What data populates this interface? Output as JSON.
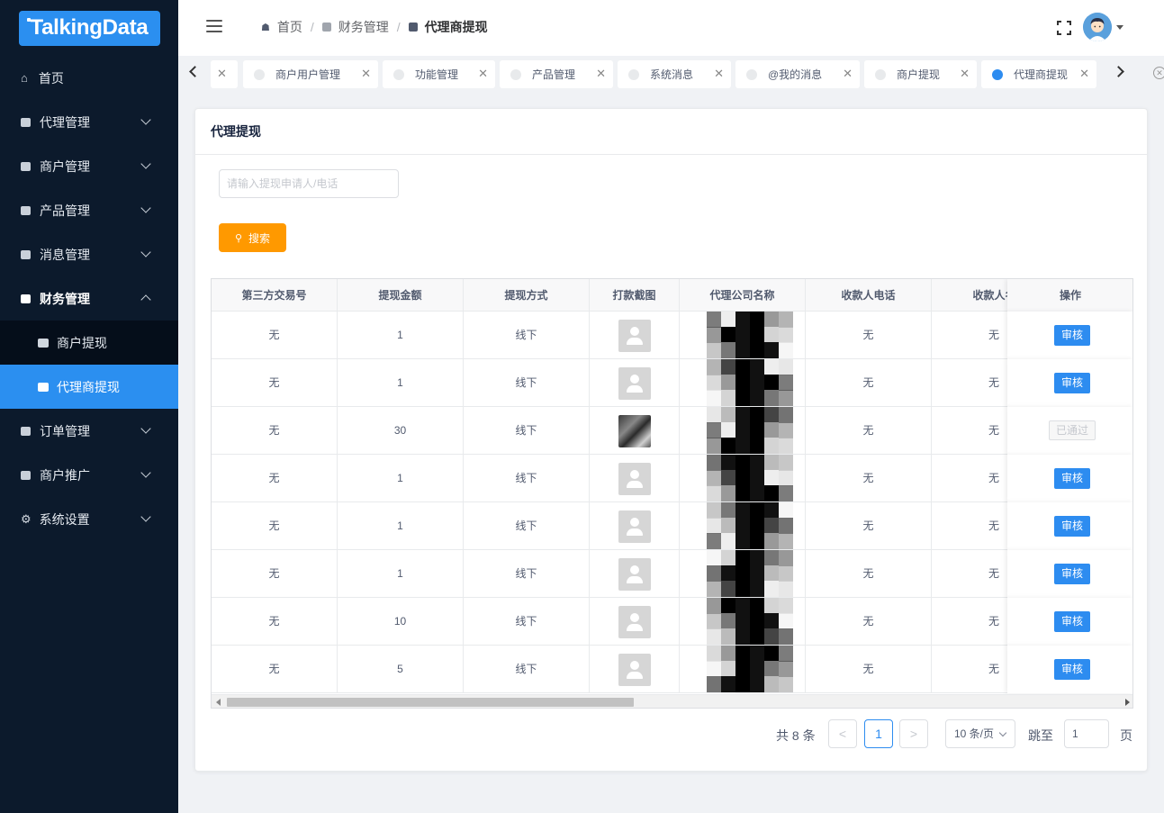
{
  "brand": {
    "logo_text": "TalkingData"
  },
  "sidebar": {
    "items": [
      {
        "label": "首页",
        "icon": "home-icon"
      },
      {
        "label": "代理管理",
        "icon": "folder-icon"
      },
      {
        "label": "商户管理",
        "icon": "folder-icon"
      },
      {
        "label": "产品管理",
        "icon": "folder-icon"
      },
      {
        "label": "消息管理",
        "icon": "folder-icon"
      },
      {
        "label": "财务管理",
        "icon": "folder-icon",
        "expanded": true
      },
      {
        "label": "订单管理",
        "icon": "folder-icon"
      },
      {
        "label": "商户推广",
        "icon": "folder-icon"
      },
      {
        "label": "系统设置",
        "icon": "gear-icon"
      }
    ],
    "finance_sub": [
      {
        "label": "商户提现",
        "selected": false
      },
      {
        "label": "代理商提现",
        "selected": true
      }
    ]
  },
  "header": {
    "breadcrumb": [
      "首页",
      "财务管理",
      "代理商提现"
    ],
    "separator": "/"
  },
  "tags": [
    {
      "label": "商户用户管理",
      "active": false
    },
    {
      "label": "功能管理",
      "active": false
    },
    {
      "label": "产品管理",
      "active": false
    },
    {
      "label": "系统消息",
      "active": false
    },
    {
      "label": "@我的消息",
      "active": false
    },
    {
      "label": "商户提现",
      "active": false
    },
    {
      "label": "代理商提现",
      "active": true
    }
  ],
  "page": {
    "title": "代理提现",
    "search_placeholder": "请输入提现申请人/电话",
    "search_button": "搜索"
  },
  "table": {
    "columns": [
      "第三方交易号",
      "提现金额",
      "提现方式",
      "打款截图",
      "代理公司名称",
      "收款人电话",
      "收款人名",
      "操作"
    ],
    "rows": [
      {
        "trade_no": "无",
        "amount": "1",
        "method": "线下",
        "screenshot": "placeholder",
        "company": "",
        "phone": "无",
        "payee": "无",
        "action": "审核"
      },
      {
        "trade_no": "无",
        "amount": "1",
        "method": "线下",
        "screenshot": "placeholder",
        "company": "",
        "phone": "无",
        "payee": "无",
        "action": "审核"
      },
      {
        "trade_no": "无",
        "amount": "30",
        "method": "线下",
        "screenshot": "photo",
        "company": "",
        "phone": "无",
        "payee": "无",
        "action": "已通过"
      },
      {
        "trade_no": "无",
        "amount": "1",
        "method": "线下",
        "screenshot": "placeholder",
        "company": "",
        "phone": "无",
        "payee": "无",
        "action": "审核"
      },
      {
        "trade_no": "无",
        "amount": "1",
        "method": "线下",
        "screenshot": "placeholder",
        "company": "",
        "phone": "无",
        "payee": "无",
        "action": "审核"
      },
      {
        "trade_no": "无",
        "amount": "1",
        "method": "线下",
        "screenshot": "placeholder",
        "company": "",
        "phone": "无",
        "payee": "无",
        "action": "审核"
      },
      {
        "trade_no": "无",
        "amount": "10",
        "method": "线下",
        "screenshot": "placeholder",
        "company": "",
        "phone": "无",
        "payee": "无",
        "action": "审核"
      },
      {
        "trade_no": "无",
        "amount": "5",
        "method": "线下",
        "screenshot": "placeholder",
        "company": "",
        "phone": "无",
        "payee": "无",
        "action": "审核"
      }
    ]
  },
  "pagination": {
    "total_text": "共 8 条",
    "current_page": "1",
    "prev": "<",
    "next": ">",
    "page_size": "10 条/页",
    "jump_label": "跳至",
    "jump_value": "1",
    "page_suffix": "页"
  },
  "colors": {
    "sidebar_bg": "#0c1a2c",
    "primary": "#2d8cf0",
    "search_button": "#ff9900"
  }
}
